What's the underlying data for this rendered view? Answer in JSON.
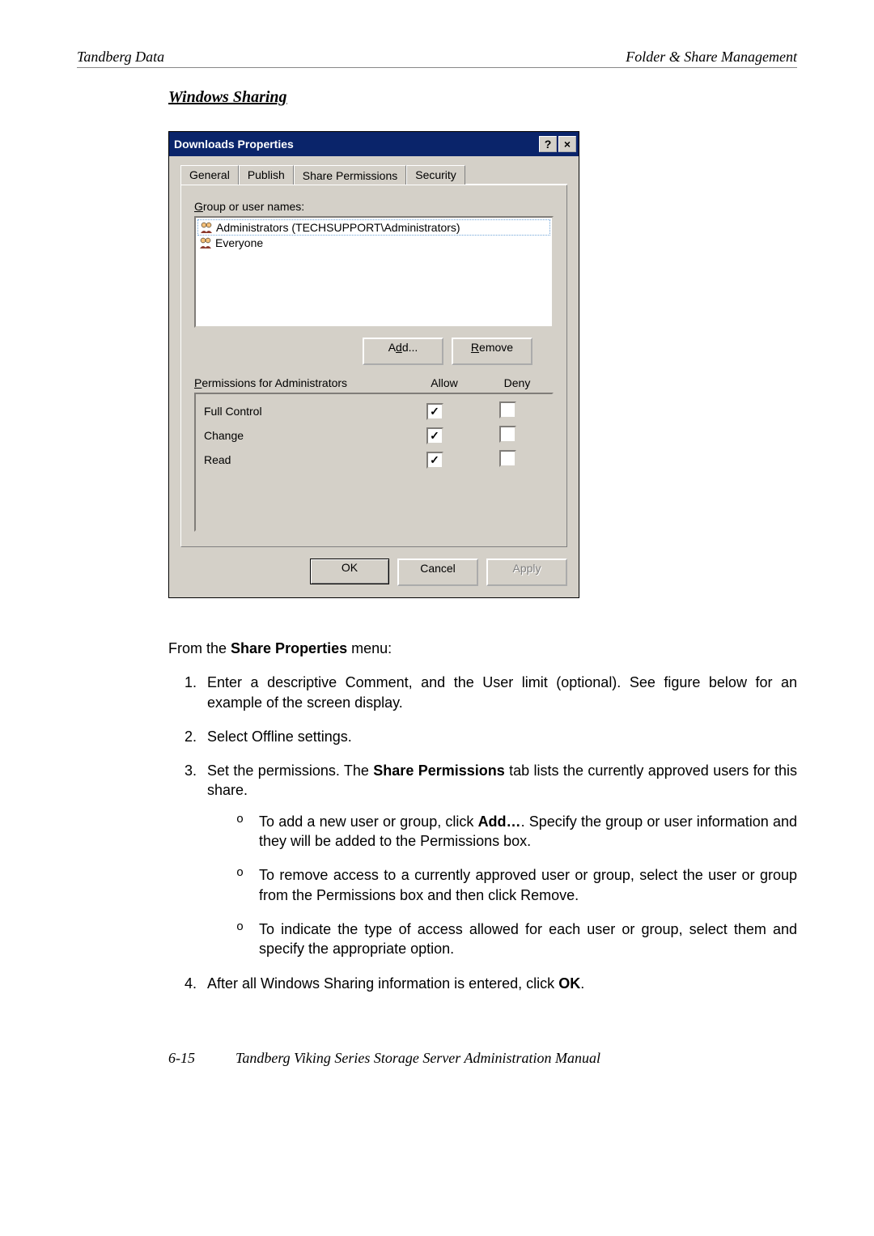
{
  "header": {
    "left": "Tandberg Data",
    "right": "Folder & Share Management"
  },
  "section_title": "Windows Sharing",
  "dialog": {
    "title": "Downloads Properties",
    "help_btn": "?",
    "close_btn": "×",
    "tabs": {
      "general": "General",
      "publish": "Publish",
      "share_permissions": "Share Permissions",
      "security": "Security"
    },
    "group_label_pre": "G",
    "group_label": "roup or user names:",
    "users": {
      "admin": "Administrators (TECHSUPPORT\\Administrators)",
      "everyone": "Everyone"
    },
    "buttons": {
      "add_pre": "A",
      "add_mid": "d",
      "add_post": "d...",
      "remove_pre": "R",
      "remove_post": "emove",
      "ok": "OK",
      "cancel": "Cancel",
      "apply": "Apply"
    },
    "perm_header_pre": "P",
    "perm_header": "ermissions for Administrators",
    "col_allow": "Allow",
    "col_deny": "Deny",
    "perms": {
      "full": "Full Control",
      "change": "Change",
      "read": "Read"
    },
    "check": "✓"
  },
  "body": {
    "intro_a": "From the ",
    "intro_b": "Share Properties",
    "intro_c": " menu:",
    "li1": "Enter a descriptive Comment, and the User limit (optional). See figure below for an example of the screen display.",
    "li2": "Select Offline settings.",
    "li3_a": "Set the permissions. The ",
    "li3_b": "Share Permissions",
    "li3_c": " tab lists the currently approved users for this share.",
    "b1_a": "To add a new user or group, click ",
    "b1_b": "Add…",
    "b1_c": ". Specify the group or user information and they will be added to the Permissions box.",
    "b2": "To remove access to a currently approved user or group, select the user or group from the Permissions box and then click Remove.",
    "b3": "To indicate the type of access allowed for each user or group, select them and specify the appropriate option.",
    "li4_a": "After all Windows Sharing information is entered, click ",
    "li4_b": "OK",
    "li4_c": "."
  },
  "footer": {
    "page": "6-15",
    "title": "Tandberg Viking Series Storage Server Administration Manual"
  }
}
